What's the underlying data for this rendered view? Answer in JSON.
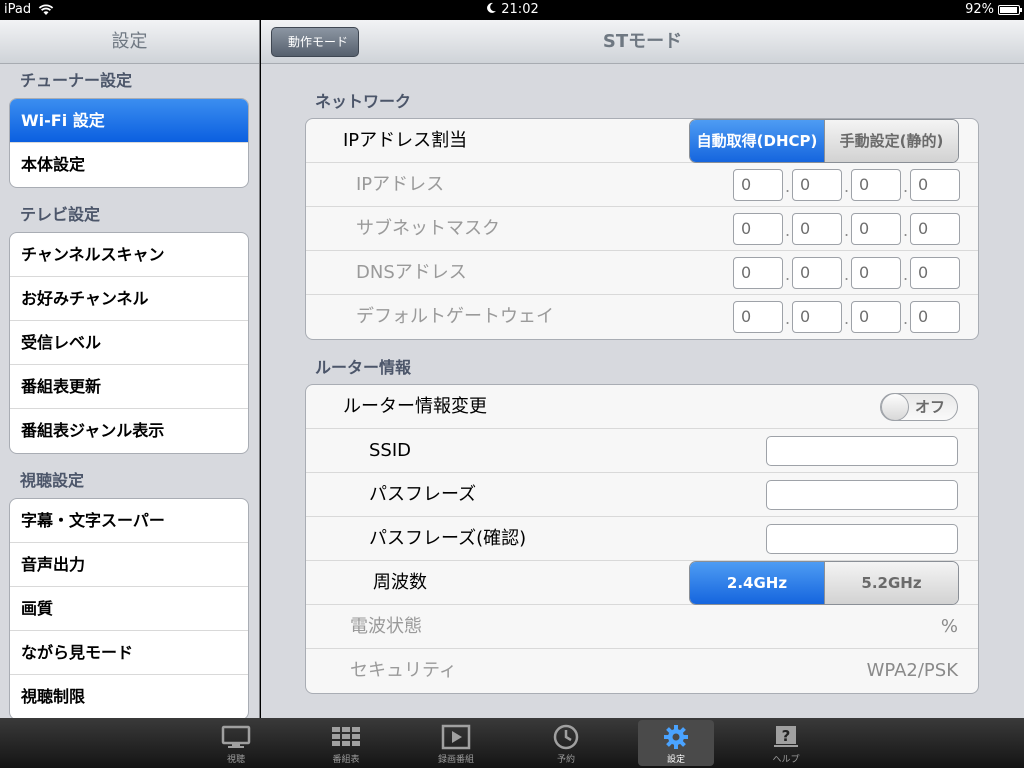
{
  "status": {
    "device": "iPad",
    "time": "21:02",
    "battery": "92%",
    "battery_level": 0.92
  },
  "sidebar": {
    "title": "設定",
    "sections": [
      {
        "title": "チューナー設定",
        "items": [
          "Wi-Fi 設定",
          "本体設定"
        ]
      },
      {
        "title": "テレビ設定",
        "items": [
          "チャンネルスキャン",
          "お好みチャンネル",
          "受信レベル",
          "番組表更新",
          "番組表ジャンル表示"
        ]
      },
      {
        "title": "視聴設定",
        "items": [
          "字幕・文字スーパー",
          "音声出力",
          "画質",
          "ながら見モード",
          "視聴制限"
        ]
      }
    ],
    "selected": "Wi-Fi 設定"
  },
  "main": {
    "back_label": "動作モード",
    "title": "STモード",
    "network": {
      "title": "ネットワーク",
      "ip_assign": {
        "label": "IPアドレス割当",
        "options": [
          "自動取得(DHCP)",
          "手動設定(静的)"
        ],
        "selected": "自動取得(DHCP)"
      },
      "fields": [
        {
          "label": "IPアドレス",
          "octets": [
            "0",
            "0",
            "0",
            "0"
          ]
        },
        {
          "label": "サブネットマスク",
          "octets": [
            "0",
            "0",
            "0",
            "0"
          ]
        },
        {
          "label": "DNSアドレス",
          "octets": [
            "0",
            "0",
            "0",
            "0"
          ]
        },
        {
          "label": "デフォルトゲートウェイ",
          "octets": [
            "0",
            "0",
            "0",
            "0"
          ]
        }
      ]
    },
    "router": {
      "title": "ルーター情報",
      "change": {
        "label": "ルーター情報変更",
        "toggle_label": "オフ",
        "on": false
      },
      "ssid": {
        "label": "SSID",
        "value": ""
      },
      "passphrase": {
        "label": "パスフレーズ",
        "value": ""
      },
      "passphrase_confirm": {
        "label": "パスフレーズ(確認)",
        "value": ""
      },
      "frequency": {
        "label": "周波数",
        "options": [
          "2.4GHz",
          "5.2GHz"
        ],
        "selected": "2.4GHz"
      },
      "signal": {
        "label": "電波状態",
        "value": "%"
      },
      "security": {
        "label": "セキュリティ",
        "value": "WPA2/PSK"
      }
    }
  },
  "tabbar": {
    "tabs": [
      {
        "label": "視聴",
        "icon": "tv-icon"
      },
      {
        "label": "番組表",
        "icon": "grid-icon"
      },
      {
        "label": "録画番組",
        "icon": "play-icon"
      },
      {
        "label": "予約",
        "icon": "clock-icon"
      },
      {
        "label": "設定",
        "icon": "gear-icon"
      },
      {
        "label": "ヘルプ",
        "icon": "help-icon"
      }
    ],
    "active": "設定"
  }
}
